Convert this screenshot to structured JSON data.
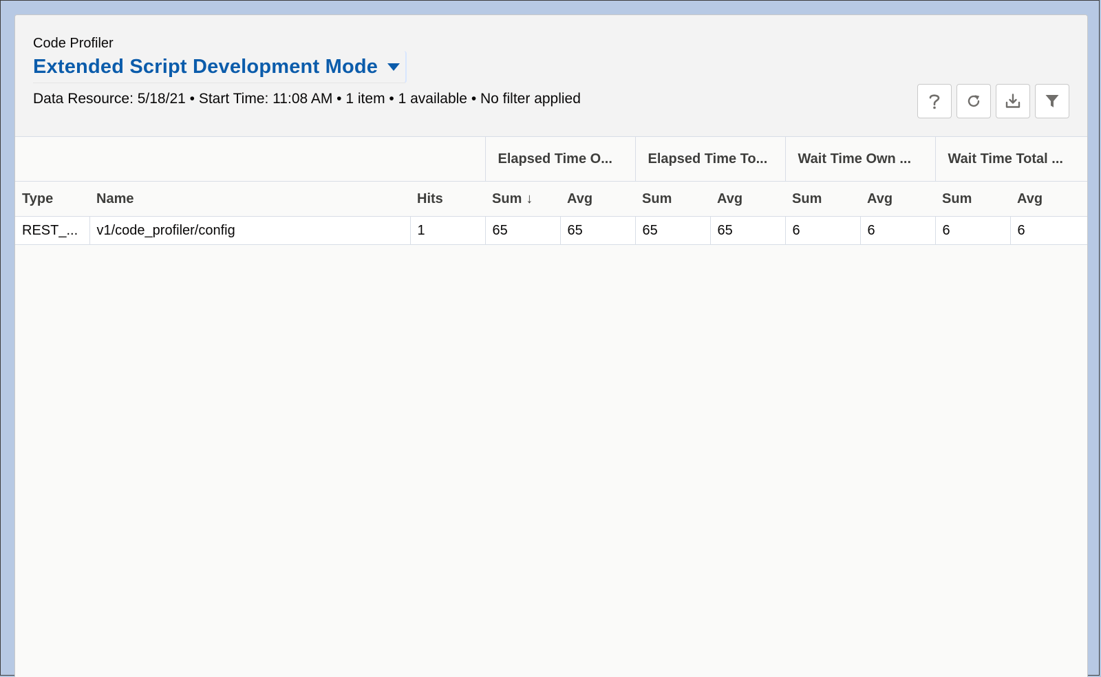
{
  "header": {
    "eyebrow": "Code Profiler",
    "title": "Extended Script Development Mode",
    "meta": "Data Resource: 5/18/21 • Start Time: 11:08 AM • 1 item • 1 available • No filter applied"
  },
  "toolbar": {
    "buttons": [
      {
        "name": "help",
        "icon": "question-icon"
      },
      {
        "name": "refresh",
        "icon": "refresh-icon"
      },
      {
        "name": "download",
        "icon": "download-icon"
      },
      {
        "name": "filter",
        "icon": "filter-icon"
      }
    ]
  },
  "table": {
    "groups": [
      "Elapsed Time O...",
      "Elapsed Time To...",
      "Wait Time Own ...",
      "Wait Time Total ..."
    ],
    "columns": {
      "type": "Type",
      "name": "Name",
      "hits": "Hits",
      "sum": "Sum",
      "avg": "Avg",
      "sort_indicator": "↓"
    },
    "rows": [
      {
        "type": "REST_...",
        "name": "v1/code_profiler/config",
        "hits": "1",
        "elapsed_own_sum": "65",
        "elapsed_own_avg": "65",
        "elapsed_total_sum": "65",
        "elapsed_total_avg": "65",
        "wait_own_sum": "6",
        "wait_own_avg": "6",
        "wait_total_sum": "6",
        "wait_total_avg": "6"
      }
    ]
  },
  "colors": {
    "accent": "#0b5cab",
    "header_bg": "#f3f3f3",
    "border": "#d8dde6",
    "outer_bg": "#b7c9e4"
  }
}
